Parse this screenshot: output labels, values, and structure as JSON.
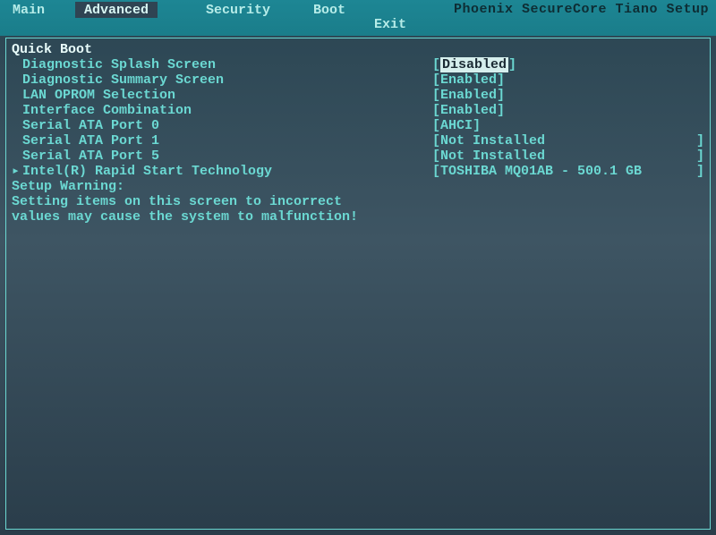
{
  "title": "Phoenix SecureCore Tiano Setup",
  "tabs": {
    "main": "Main",
    "advanced": "Advanced",
    "security": "Security",
    "boot": "Boot",
    "exit": "Exit"
  },
  "active_tab": "Advanced",
  "section_header": "Quick Boot",
  "settings": [
    {
      "label": "Diagnostic Splash Screen",
      "value": "Disabled",
      "selected": true,
      "brackets": true
    },
    {
      "label": "Diagnostic Summary Screen",
      "value": "Enabled",
      "brackets": true
    },
    {
      "label": "LAN OPROM Selection",
      "value": "Enabled",
      "brackets": true
    },
    {
      "label": "Interface Combination",
      "value": "Enabled",
      "brackets": true
    },
    {
      "label": "Serial ATA Port 0",
      "value": "AHCI",
      "brackets": true
    },
    {
      "label": "Serial ATA Port 1",
      "value": "Not Installed",
      "brackets": "open",
      "close_far": true
    },
    {
      "label": "Serial ATA Port 5",
      "value": "Not Installed",
      "brackets": "open",
      "close_far": true
    },
    {
      "label": "Intel(R) Rapid Start Technology",
      "value": "TOSHIBA MQ01AB - 500.1 GB",
      "brackets": "open",
      "close_far": true,
      "submenu": true
    }
  ],
  "warning_label": "Setup Warning:",
  "warning_text": "Setting items on this screen to incorrect values may cause the system to malfunction!"
}
